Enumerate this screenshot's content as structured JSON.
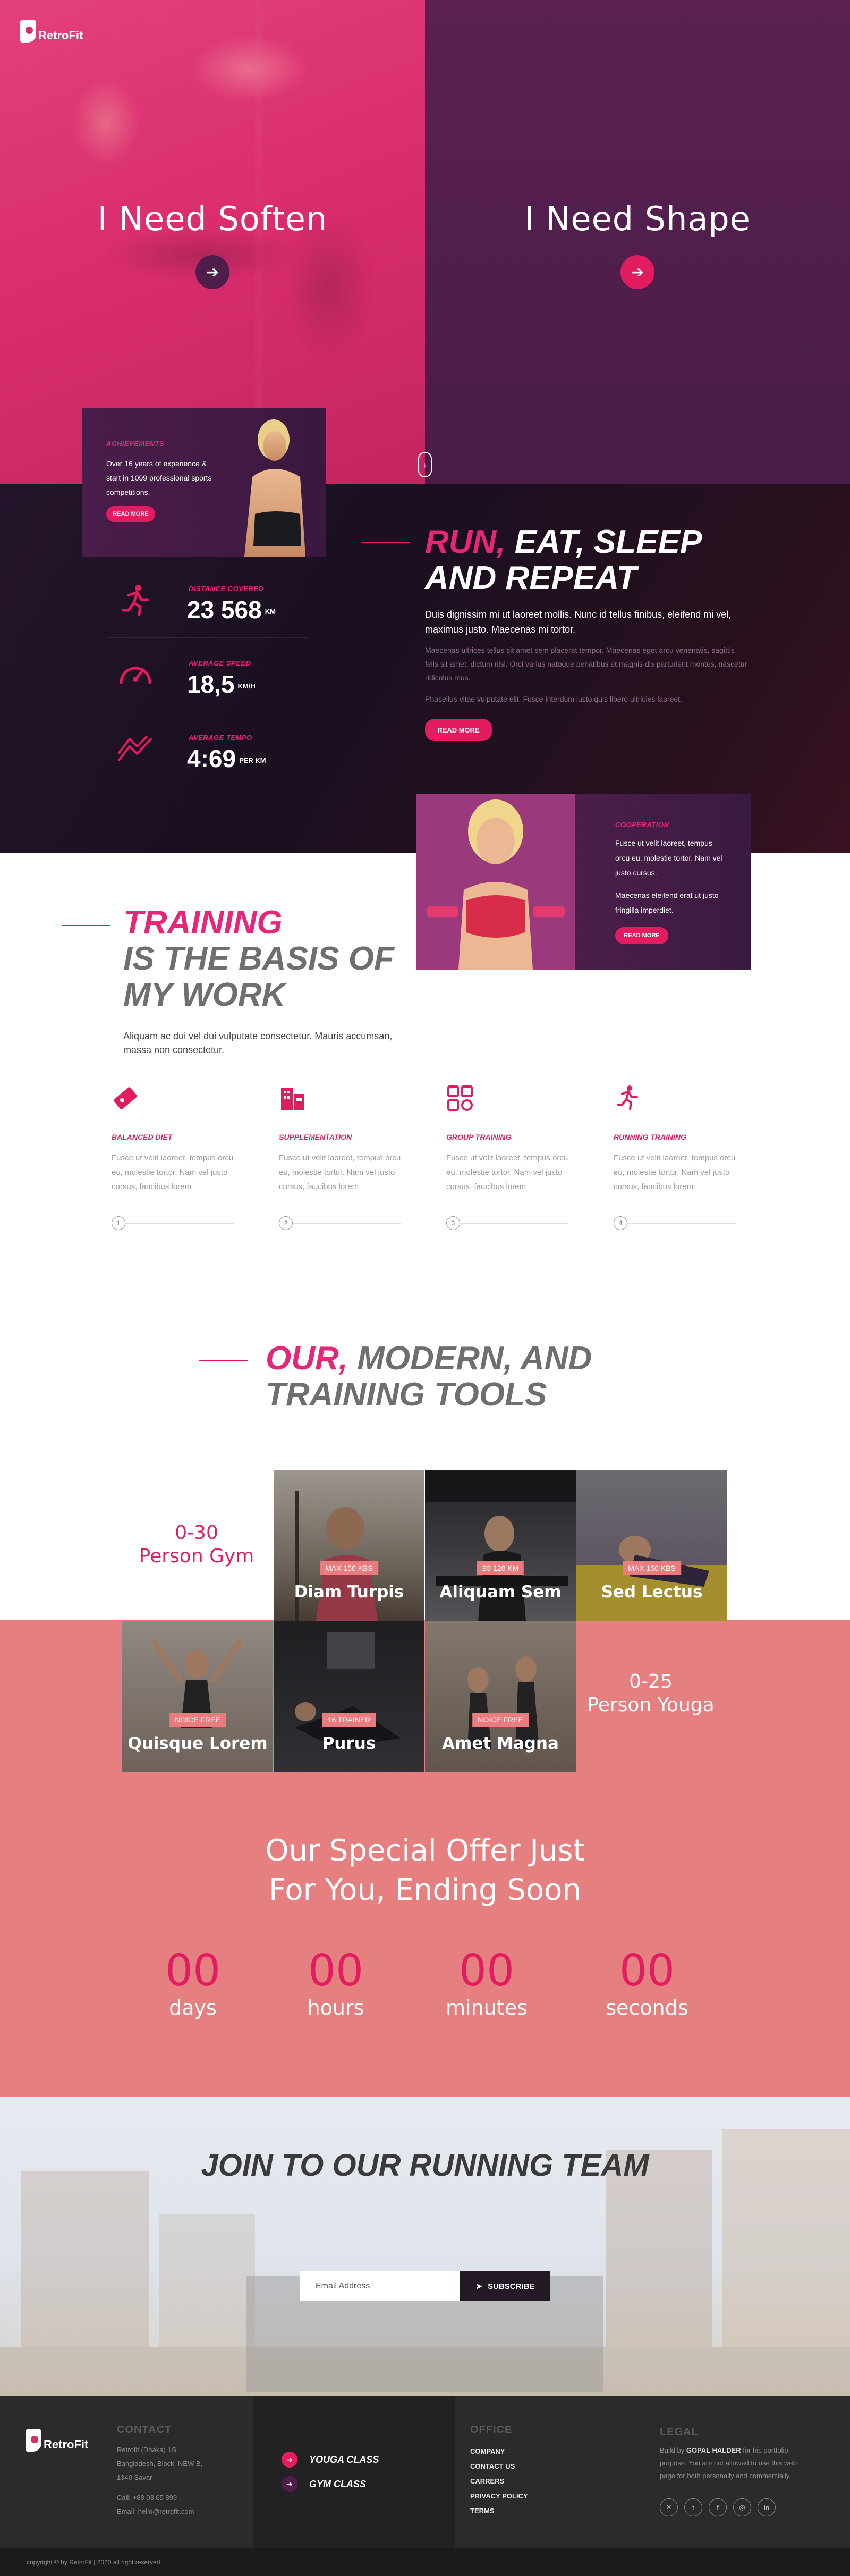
{
  "brand": {
    "name": "RetroFit",
    "accent": "#e31b5f",
    "dark": "#1a1020",
    "coral": "#e67f80"
  },
  "hero": {
    "left": {
      "title": "I Need Soften",
      "button_icon": "arrow-right-icon"
    },
    "right": {
      "title": "I Need Shape",
      "button_icon": "arrow-right-icon"
    },
    "scroll_icon": "mouse-scroll-icon"
  },
  "achievements": {
    "label": "ACHIEVEMENTS",
    "text": "Over 16 years of experience & start in 1099 professional sports competitions.",
    "button": "READ MORE"
  },
  "stats": [
    {
      "label": "DISTANCE COVERED",
      "value": "23 568",
      "unit": "KM",
      "icon": "runner-icon"
    },
    {
      "label": "AVERAGE SPEED",
      "value": "18,5",
      "unit": "KM/H",
      "icon": "speedometer-icon"
    },
    {
      "label": "AVERAGE TEMPO",
      "value": "4:69",
      "unit": "PER KM",
      "icon": "trend-icon"
    }
  ],
  "run_section": {
    "heading_accent": "RUN,",
    "heading_rest1": "EAT, SLEEP",
    "heading_rest2": "AND REPEAT",
    "lead": "Duis dignissim mi ut laoreet mollis. Nunc id tellus finibus, eleifend mi vel, maximus justo. Maecenas mi tortor.",
    "para1": "Maecenas ultrices tellus sit amet sem placerat tempor. Maecenas eget arcu venenatis, sagittis felis sit amet, dictum nisl. Orci varius natoque penatibus et magnis dis parturient montes, nascetur ridiculus mus.",
    "para2": "Phasellus vitae vulputate elit. Fusce interdum justo quis libero ultricies laoreet.",
    "button": "READ MORE"
  },
  "cooperation": {
    "label": "COOPERATION",
    "text1": "Fusce ut velit laoreet, tempus orcu eu, molestie tortor. Nam vel justo cursus.",
    "text2": "Maecenas eleifend erat ut justo fringilla imperdiet.",
    "button": "READ MORE"
  },
  "training": {
    "heading_accent": "TRAINING",
    "heading_line2": "IS THE BASIS OF",
    "heading_line3": "MY WORK",
    "text": "Aliquam ac dui vel dui vulputate consectetur. Mauris accumsan, massa non consectetur.",
    "features": [
      {
        "icon": "ticket-icon",
        "title": "BALANCED DIET",
        "text": "Fusce ut velit laoreet, tempus orcu eu, molestie tortor. Nam vel justo cursus, faucibus lorem",
        "num": "1"
      },
      {
        "icon": "building-icon",
        "title": "SUPPLEMENTATION",
        "text": "Fusce ut velit laoreet, tempus orcu eu, molestie tortor. Nam vel justo cursus, faucibus lorem",
        "num": "2"
      },
      {
        "icon": "group-icon",
        "title": "GROUP TRAINING",
        "text": "Fusce ut velit laoreet, tempus orcu eu, molestie tortor. Nam vel justo cursus, faucibus lorem",
        "num": "3"
      },
      {
        "icon": "runner-icon",
        "title": "RUNNING TRAINING",
        "text": "Fusce ut velit laoreet, tempus orcu eu, molestie tortor. Nam vel justo cursus, faucibus lorem",
        "num": "4"
      }
    ]
  },
  "tools": {
    "heading_accent": "OUR,",
    "heading_rest": "MODERN, AND",
    "heading_line2": "TRAINING TOOLS",
    "gym_label_line1": "0-30",
    "gym_label_line2": "Person Gym",
    "yoga_label_line1": "0-25",
    "yoga_label_line2": "Person Youga",
    "gym_tiles": [
      {
        "tag": "MAX 150 KBS",
        "name": "Diam Turpis"
      },
      {
        "tag": "80-120 KM",
        "name": "Aliquam Sem"
      },
      {
        "tag": "MAX 150 KBS",
        "name": "Sed Lectus"
      }
    ],
    "yoga_tiles": [
      {
        "tag": "NOICE FREE",
        "name": "Quisque Lorem"
      },
      {
        "tag": "16 TRAINER",
        "name": "Purus"
      },
      {
        "tag": "NOICE FREE",
        "name": "Amet Magna"
      }
    ]
  },
  "offer": {
    "line1": "Our Special Offer Just",
    "line2": "For You, Ending Soon",
    "countdown": [
      {
        "value": "00",
        "label": "days"
      },
      {
        "value": "00",
        "label": "hours"
      },
      {
        "value": "00",
        "label": "minutes"
      },
      {
        "value": "00",
        "label": "seconds"
      }
    ]
  },
  "running_team": {
    "heading": "JOIN TO OUR RUNNING TEAM",
    "email_placeholder": "Email Address",
    "subscribe": "SUBSCRIBE"
  },
  "footer": {
    "contact_title": "CONTACT",
    "address1": "Retrofit (Dhaka) 1G",
    "address2": "Bangladesh, Block: NEW B,",
    "address3": "1340 Savar",
    "phone": "Call: +88 03 65 899",
    "email": "Email: hello@retrofit.com",
    "classes": [
      {
        "label": "YOUGA CLASS"
      },
      {
        "label": "GYM CLASS"
      }
    ],
    "office_title": "OFFICE",
    "office_links": [
      "COMPANY",
      "CONTACT US",
      "CARRERS",
      "PRIVACY POLICY",
      "TERMS"
    ],
    "legal_title": "LEGAL",
    "legal_text_pre": "Build by ",
    "legal_author": "GOPAL HALDER",
    "legal_text_post": " for his portfolio purpose. You are not allowed to use this web page for both personally and commercially.",
    "social": [
      {
        "icon": "twitter-icon",
        "glyph": "✕"
      },
      {
        "icon": "twitter-bird-icon",
        "glyph": "t"
      },
      {
        "icon": "facebook-icon",
        "glyph": "f"
      },
      {
        "icon": "instagram-icon",
        "glyph": "◎"
      },
      {
        "icon": "linkedin-icon",
        "glyph": "in"
      }
    ],
    "copyright": "copyright © by RetroFit | 2020 all right reserved."
  }
}
